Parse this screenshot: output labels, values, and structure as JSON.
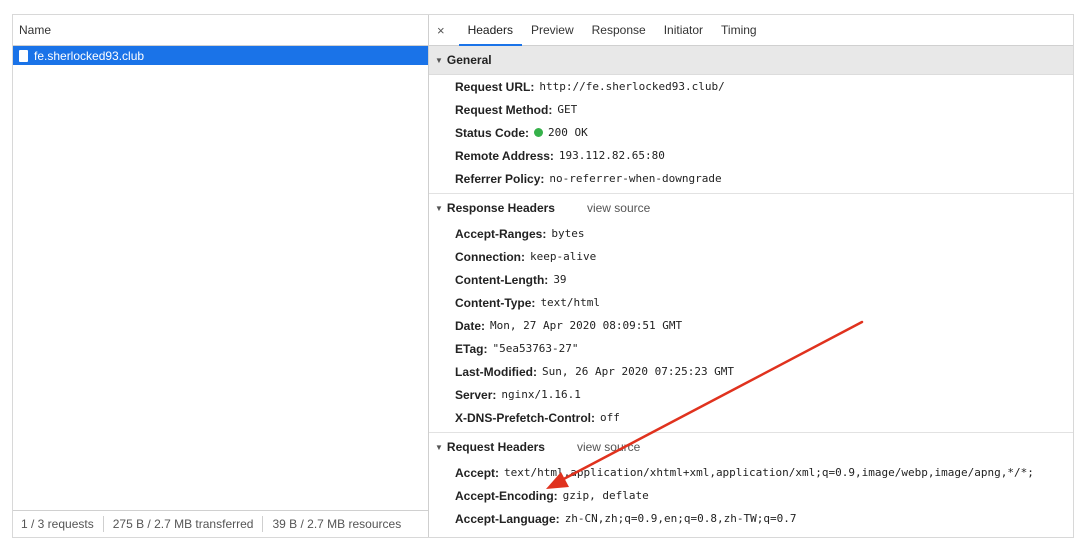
{
  "left": {
    "column_header": "Name",
    "requests": [
      {
        "name": "fe.sherlocked93.club"
      }
    ],
    "status_bar": {
      "requests": "1 / 3 requests",
      "transferred": "275 B / 2.7 MB transferred",
      "resources": "39 B / 2.7 MB resources"
    }
  },
  "tabs": {
    "close": "×",
    "items": [
      "Headers",
      "Preview",
      "Response",
      "Initiator",
      "Timing"
    ],
    "active": "Headers"
  },
  "general": {
    "title": "General",
    "rows": [
      {
        "key": "Request URL:",
        "value": "http://fe.sherlocked93.club/"
      },
      {
        "key": "Request Method:",
        "value": "GET"
      },
      {
        "key": "Status Code:",
        "value": "200 OK"
      },
      {
        "key": "Remote Address:",
        "value": "193.112.82.65:80"
      },
      {
        "key": "Referrer Policy:",
        "value": "no-referrer-when-downgrade"
      }
    ]
  },
  "response_headers": {
    "title": "Response Headers",
    "view_source": "view source",
    "rows": [
      {
        "key": "Accept-Ranges:",
        "value": "bytes"
      },
      {
        "key": "Connection:",
        "value": "keep-alive"
      },
      {
        "key": "Content-Length:",
        "value": "39"
      },
      {
        "key": "Content-Type:",
        "value": "text/html"
      },
      {
        "key": "Date:",
        "value": "Mon, 27 Apr 2020 08:09:51 GMT"
      },
      {
        "key": "ETag:",
        "value": "\"5ea53763-27\""
      },
      {
        "key": "Last-Modified:",
        "value": "Sun, 26 Apr 2020 07:25:23 GMT"
      },
      {
        "key": "Server:",
        "value": "nginx/1.16.1"
      },
      {
        "key": "X-DNS-Prefetch-Control:",
        "value": "off"
      }
    ]
  },
  "request_headers": {
    "title": "Request Headers",
    "view_source": "view source",
    "rows": [
      {
        "key": "Accept:",
        "value": "text/html,application/xhtml+xml,application/xml;q=0.9,image/webp,image/apng,*/*;"
      },
      {
        "key": "Accept-Encoding:",
        "value": "gzip, deflate"
      },
      {
        "key": "Accept-Language:",
        "value": "zh-CN,zh;q=0.9,en;q=0.8,zh-TW;q=0.7"
      }
    ]
  },
  "colors": {
    "selection": "#1a73e8",
    "status_ok": "#36b14a",
    "annotation_arrow": "#e0321e"
  }
}
